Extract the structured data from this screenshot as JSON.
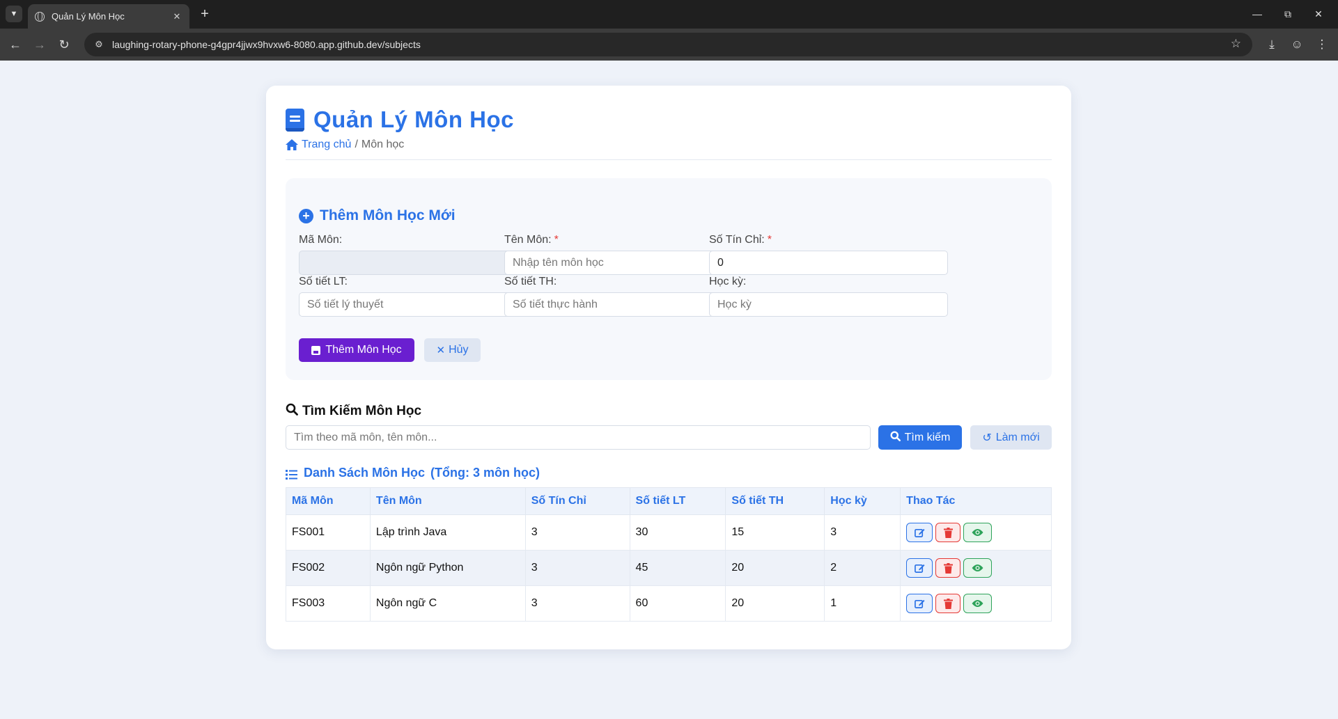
{
  "browser": {
    "tab_title": "Quản Lý Môn Học",
    "url": "laughing-rotary-phone-g4gpr4jjwx9hvxw6-8080.app.github.dev/subjects"
  },
  "header": {
    "title": "Quản Lý Môn Học",
    "breadcrumb_home": "Trang chủ",
    "breadcrumb_sep": "/",
    "breadcrumb_current": "Môn học"
  },
  "form": {
    "title": "Thêm Môn Học Mới",
    "fields": {
      "ma_mon": {
        "label": "Mã Môn:",
        "value": "",
        "placeholder": ""
      },
      "ten_mon": {
        "label": "Tên Môn:",
        "required": "*",
        "value": "",
        "placeholder": "Nhập tên môn học"
      },
      "so_tin_chi": {
        "label": "Số Tín Chỉ:",
        "required": "*",
        "value": "0",
        "placeholder": ""
      },
      "so_tiet_lt": {
        "label": "Số tiết LT:",
        "value": "",
        "placeholder": "Số tiết lý thuyết"
      },
      "so_tiet_th": {
        "label": "Số tiết TH:",
        "value": "",
        "placeholder": "Số tiết thực hành"
      },
      "hoc_ky": {
        "label": "Học kỳ:",
        "value": "",
        "placeholder": "Học kỳ"
      }
    },
    "submit_label": "Thêm Môn Học",
    "cancel_label": "Hủy"
  },
  "search": {
    "title": "Tìm Kiếm Môn Học",
    "placeholder": "Tìm theo mã môn, tên môn...",
    "search_label": "Tìm kiếm",
    "refresh_label": "Làm mới"
  },
  "list": {
    "title": "Danh Sách Môn Học",
    "total": "(Tổng: 3 môn học)",
    "columns": [
      "Mã Môn",
      "Tên Môn",
      "Số Tín Chỉ",
      "Số tiết LT",
      "Số tiết TH",
      "Học kỳ",
      "Thao Tác"
    ],
    "rows": [
      [
        "FS001",
        "Lập trình Java",
        "3",
        "30",
        "15",
        "3"
      ],
      [
        "FS002",
        "Ngôn ngữ Python",
        "3",
        "45",
        "20",
        "2"
      ],
      [
        "FS003",
        "Ngôn ngữ C",
        "3",
        "60",
        "20",
        "1"
      ]
    ]
  },
  "colors": {
    "primary": "#2b72e6",
    "submit": "#6a1fd0",
    "danger": "#e53935",
    "success": "#2ea35a"
  }
}
